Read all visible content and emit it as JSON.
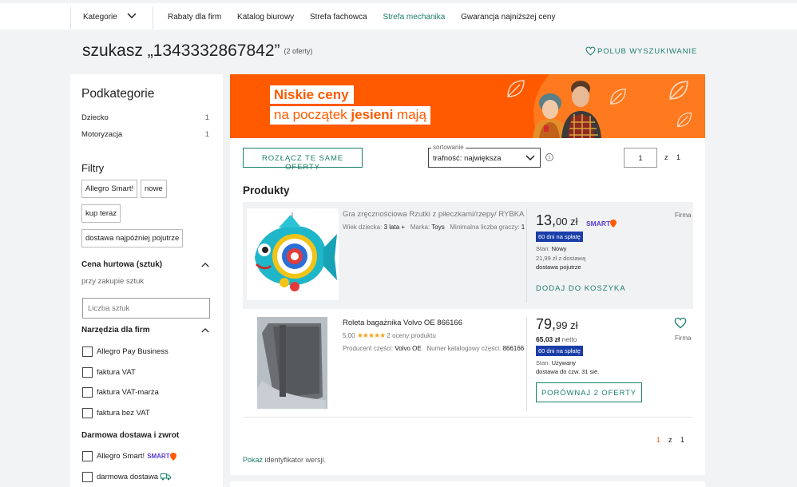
{
  "topnav": {
    "category_label": "Kategorie",
    "links": [
      {
        "label": "Rabaty dla firm",
        "accent": false
      },
      {
        "label": "Katalog biurowy",
        "accent": false
      },
      {
        "label": "Strefa fachowca",
        "accent": false
      },
      {
        "label": "Strefa mechanika",
        "accent": true
      },
      {
        "label": "Gwarancja najniższej ceny",
        "accent": false
      }
    ]
  },
  "search": {
    "title": "szukasz „1343332867842”",
    "count": "(2 oferty)",
    "like_label": "POLUB WYSZUKIWANIE"
  },
  "sidebar": {
    "subcategories_title": "Podkategorie",
    "subcategories": [
      {
        "label": "Dziecko",
        "count": "1"
      },
      {
        "label": "Motoryzacja",
        "count": "1"
      }
    ],
    "filters_title": "Filtry",
    "chips": [
      "Allegro Smart!",
      "nowe",
      "kup teraz",
      "dostawa najpóźniej pojutrze"
    ],
    "price_section": "Cena hurtowa (sztuk)",
    "price_sub": "przy zakupie sztuk",
    "qty_placeholder": "Liczba sztuk",
    "tools_section": "Narzędzia dla firm",
    "tools": [
      "Allegro Pay Business",
      "faktura VAT",
      "faktura VAT-marża",
      "faktura bez VAT"
    ],
    "delivery_section": "Darmowa dostawa i zwrot",
    "delivery": [
      "Allegro Smart!",
      "darmowa dostawa"
    ],
    "smart_badge": "SMART"
  },
  "banner": {
    "line1": "Niskie ceny",
    "line2_pre": "na początek ",
    "line2_bold": "jesieni",
    "line2_post": " mają"
  },
  "toolbar": {
    "merge_button": "ROZŁĄCZ TE SAME OFERTY",
    "sort_label": "sortowanie",
    "sort_value": "trafność: największa",
    "page_value": "1",
    "page_of": "z",
    "page_total": "1"
  },
  "products_heading": "Produkty",
  "products": [
    {
      "title": "Gra zręcznościowa Rzutki z piłeczkami/rzepy/ RYBKA",
      "meta_1_label": "Wiek dziecka:",
      "meta_1_value": "3 lata +",
      "meta_2_label": "Marka:",
      "meta_2_value": "Toys",
      "meta_3_label": "Minimalna liczba graczy:",
      "meta_3_value": "1",
      "price_main": "13,",
      "price_cents": "00 zł",
      "smart": "SMART",
      "installments": "60 dni na spłatę",
      "condition_label": "Stan:",
      "condition_value": "Nowy",
      "delivery_price": "21,99 zł z dostawą",
      "delivery_when": "dostawa pojutrze",
      "seller": "Firma",
      "action": "DODAJ DO KOSZYKA"
    },
    {
      "title": "Roleta bagażnika Volvo OE 866166",
      "rating": "5,00",
      "stars": "★★★★★",
      "reviews": "2 oceny produktu",
      "meta_1_label": "Producent części:",
      "meta_1_value": "Volvo OE",
      "meta_2_label": "Numer katalogowy części:",
      "meta_2_value": "866166",
      "price_main": "79,",
      "price_cents": "99 zł",
      "net_price": "65,03 zł",
      "net_label": "netto",
      "installments": "60 dni na spłatę",
      "condition_label": "Stan:",
      "condition_value": "Używany",
      "delivery_when": "dostawa do czw. 31 sie.",
      "seller": "Firma",
      "action": "PORÓWNAJ 2 OFERTY"
    }
  ],
  "pagination": {
    "current": "1",
    "of": "z",
    "total": "1"
  },
  "footer": {
    "link": "Pokaż",
    "text": " identyfikator wersji."
  },
  "colors": {
    "accent": "#1a7f6b",
    "brand": "#ff5a00",
    "smart": "#5a3bd4"
  }
}
